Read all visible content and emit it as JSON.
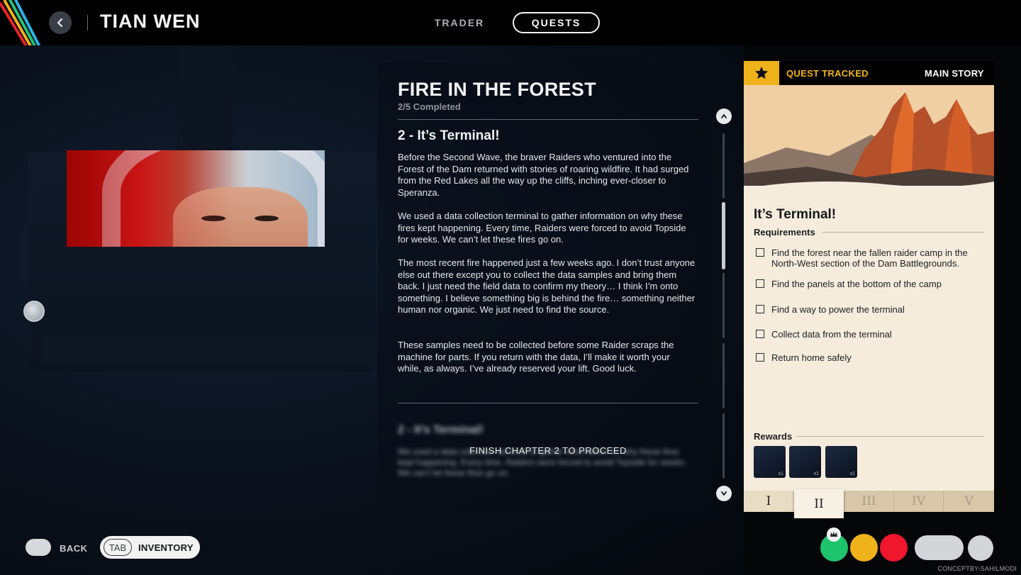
{
  "header": {
    "npc_name": "TIAN WEN",
    "tabs": [
      {
        "label": "TRADER",
        "active": false
      },
      {
        "label": "QUESTS",
        "active": true
      }
    ]
  },
  "quest": {
    "title": "FIRE IN THE FOREST",
    "progress": "2/5 Completed",
    "chapter_heading": "2 - It’s Terminal!",
    "paragraphs": [
      "Before the Second Wave, the braver Raiders who ventured into the Forest of the Dam returned with stories of roaring wildfire. It had surged from the Red Lakes all the way up the cliffs, inching ever-closer to Speranza.",
      "We used a data collection terminal to gather information on why these fires kept happening. Every time, Raiders were forced to avoid Topside for weeks. We can’t let these fires go on.",
      "The most recent fire happened just a few weeks ago. I don’t trust anyone else out there except you to collect the data samples and bring them back. I just need the field data to confirm my theory… I think I’m onto something. I believe something big is behind the fire… something neither human nor organic. We just need to find the source.",
      "These samples need to be collected before some Raider scraps the machine for parts. If you return with the data, I’ll make it worth your while, as always. I’ve already reserved your lift. Good luck."
    ],
    "locked_message": "FINISH CHAPTER 2 TO PROCEED"
  },
  "card": {
    "tracked_label": "QUEST TRACKED",
    "story_label": "MAIN STORY",
    "title": "It’s Terminal!",
    "requirements_label": "Requirements",
    "requirements": [
      {
        "text": "Find the forest near the fallen raider camp in the North-West section of the Dam Battlegrounds.",
        "checked": false
      },
      {
        "text": "Find the panels at the bottom of the camp",
        "checked": false
      },
      {
        "text": "Find a way to power the terminal",
        "checked": false
      },
      {
        "text": "Collect data from the terminal",
        "checked": false
      },
      {
        "text": "Return home safely",
        "checked": false
      }
    ],
    "rewards_label": "Rewards",
    "rewards": [
      {
        "qty": "x1"
      },
      {
        "qty": "x1"
      },
      {
        "qty": "x1"
      }
    ],
    "chapters": [
      {
        "label": "I",
        "state": "done"
      },
      {
        "label": "II",
        "state": "active"
      },
      {
        "label": "III",
        "state": "locked"
      },
      {
        "label": "IV",
        "state": "locked"
      },
      {
        "label": "V",
        "state": "locked"
      }
    ]
  },
  "footer": {
    "back_label": "BACK",
    "tab_key": "TAB",
    "inventory_label": "INVENTORY",
    "credit": "CONCEPTBY-SAHILMODI"
  },
  "colors": {
    "accent_yellow": "#f0b21a",
    "status_green": "#1ec46b",
    "status_red": "#f0162c",
    "card_bg": "#f5ecdc"
  },
  "icons": [
    "back-arrow-icon",
    "star-icon",
    "scroll-up-icon",
    "scroll-down-icon",
    "crown-icon"
  ]
}
